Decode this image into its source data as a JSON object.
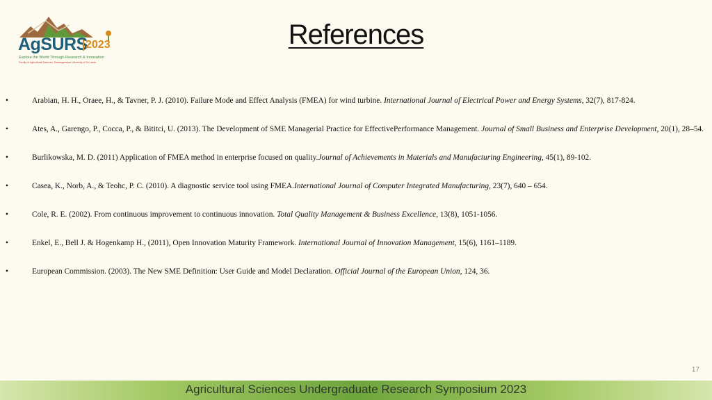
{
  "logo": {
    "word": "AgSURS",
    "year": "2023",
    "tagline": "Explore the World Through Research & Innovation",
    "subline": "Faculty of Agricultural Sciences, Sabaragamuwa University of Sri Lanka"
  },
  "title": "References",
  "references": [
    {
      "bullet": "•",
      "before": "Arabian, H. H., Oraee, H., & Tavner, P. J. (2010). Failure Mode and Effect Analysis (FMEA) for wind turbine. ",
      "journal": "International Journal of Electrical Power and Energy Systems",
      "after": ", 32(7), 817-824."
    },
    {
      "bullet": "•",
      "before": "Ates, A., Garengo, P., Cocca, P., & Bititci, U. (2013). The Development of SME Managerial Practice for EffectivePerformance Management. ",
      "journal": "Journal of Small Business and Enterprise Development",
      "after": ", 20(1), 28–54."
    },
    {
      "bullet": "•",
      "before": "Burlikowska, M. D. (2011) Application of FMEA method in enterprise focused on quality.",
      "journal": "Journal of Achievements in Materials and Manufacturing Engineering,",
      "after": " 45(1), 89-102."
    },
    {
      "bullet": "•",
      "before": "Casea, K., Norb, A., & Teohc, P. C. (2010). A diagnostic service tool using FMEA.",
      "journal": "International Journal of Computer Integrated Manufacturing",
      "after": ", 23(7), 640 – 654."
    },
    {
      "bullet": "•",
      "before": "Cole, R. E. (2002). From continuous improvement to continuous innovation. ",
      "journal": "Total Quality Management & Business Excellence",
      "after": ", 13(8), 1051-1056."
    },
    {
      "bullet": "•",
      "before": "Enkel, E., Bell J. & Hogenkamp H., (2011), Open Innovation Maturity Framework. ",
      "journal": "International Journal of Innovation Management",
      "after": ", 15(6), 1161–1189."
    },
    {
      "bullet": "•",
      "before": "European Commission. (2003). The New SME Definition: User Guide and Model Declaration. ",
      "journal": "Official Journal of the European Union",
      "after": ", 124, 36."
    }
  ],
  "footer": {
    "text": "Agricultural Sciences Undergraduate Research Symposium 2023"
  },
  "page_number": "17",
  "colors": {
    "background": "#fdfbf0",
    "logo_blue": "#1f5f7a",
    "logo_orange": "#d68a1c",
    "footer_green": "#6da53c"
  }
}
